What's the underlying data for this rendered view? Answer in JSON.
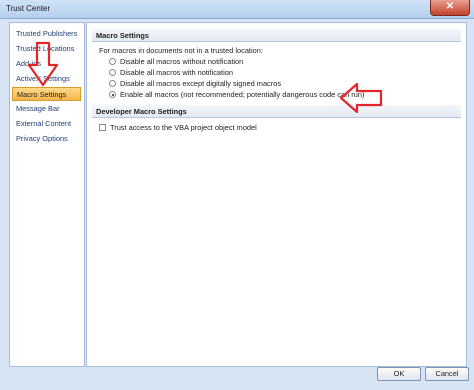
{
  "window": {
    "title": "Trust Center",
    "close_symbol": "✕"
  },
  "sidebar": {
    "items": [
      {
        "label": "Trusted Publishers",
        "selected": false
      },
      {
        "label": "Trusted Locations",
        "selected": false
      },
      {
        "label": "Add-ins",
        "selected": false
      },
      {
        "label": "ActiveX Settings",
        "selected": false
      },
      {
        "label": "Macro Settings",
        "selected": true
      },
      {
        "label": "Message Bar",
        "selected": false
      },
      {
        "label": "External Content",
        "selected": false
      },
      {
        "label": "Privacy Options",
        "selected": false
      }
    ]
  },
  "macro_settings": {
    "header": "Macro Settings",
    "intro": "For macros in documents not in a trusted location:",
    "options": [
      {
        "label": "Disable all macros without notification",
        "checked": false
      },
      {
        "label": "Disable all macros with notification",
        "checked": false
      },
      {
        "label": "Disable all macros except digitally signed macros",
        "checked": false
      },
      {
        "label": "Enable all macros (not recommended; potentially dangerous code can run)",
        "checked": true
      }
    ]
  },
  "developer": {
    "header": "Developer Macro Settings",
    "trust_vba_label": "Trust access to the VBA project object model",
    "trust_vba_checked": false
  },
  "buttons": {
    "ok": "OK",
    "cancel": "Cancel"
  },
  "colors": {
    "annotation_arrow": "#e4262a",
    "selected_item": "#f5b54a"
  },
  "icons": [
    "close-icon",
    "down-arrow-annotation",
    "left-arrow-annotation"
  ]
}
